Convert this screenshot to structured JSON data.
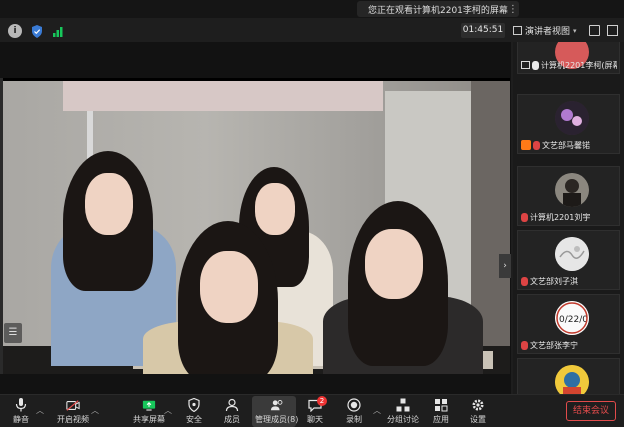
{
  "banner": {
    "text": "您正在观看计算机2201李柯的屏幕"
  },
  "toolbar": {
    "timer": "01:45:51",
    "view_label": "演讲者视图"
  },
  "participants": [
    {
      "name": "计算机2201李柯(屏幕…",
      "icon": "share-icon",
      "muted": false
    },
    {
      "name": "文艺部马馨锘",
      "icon": "orange-app-icon",
      "muted": true
    },
    {
      "name": "计算机2201刘宇",
      "icon": "mic-icon",
      "muted": true
    },
    {
      "name": "文艺部刘子淇",
      "icon": "mic-icon",
      "muted": true
    },
    {
      "name": "文艺部张李宁",
      "icon": "mic-icon",
      "muted": true
    }
  ],
  "bottom_bar": {
    "mute": "静音",
    "video": "开启视频",
    "share": "共享屏幕",
    "security": "安全",
    "members": "成员",
    "manage_members": "管理成员(8)",
    "chat": "聊天",
    "chat_badge": "2",
    "record": "录制",
    "breakout": "分组讨论",
    "apps": "应用",
    "settings": "设置",
    "end": "结束会议"
  },
  "colors": {
    "accent_green": "#17c75b",
    "danger_red": "#e24b4b",
    "orange": "#ff7a17"
  }
}
